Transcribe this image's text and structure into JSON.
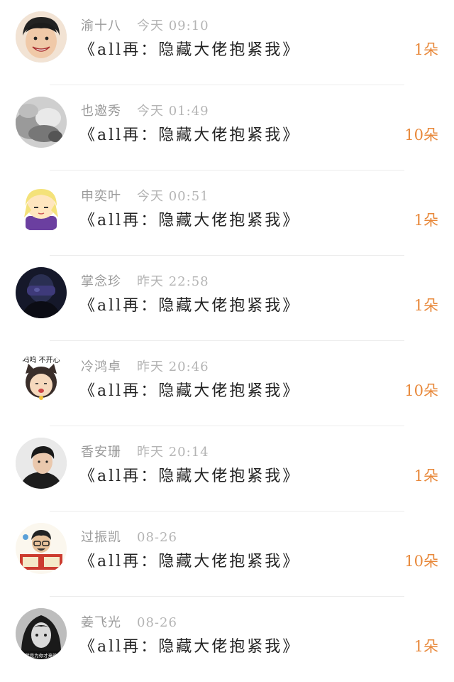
{
  "gifts": [
    {
      "name": "渝十八",
      "time": "今天 09:10",
      "title": "《all再：隐藏大佬抱紧我》",
      "count": "1朵",
      "avatar": "boy-smiling"
    },
    {
      "name": "也邀秀",
      "time": "今天 01:49",
      "title": "《all再：隐藏大佬抱紧我》",
      "count": "10朵",
      "avatar": "smoke"
    },
    {
      "name": "申奕叶",
      "time": "今天 00:51",
      "title": "《all再：隐藏大佬抱紧我》",
      "count": "1朵",
      "avatar": "cartoon-blonde"
    },
    {
      "name": "掌念珍",
      "time": "昨天 22:58",
      "title": "《all再：隐藏大佬抱紧我》",
      "count": "1朵",
      "avatar": "dark-figure"
    },
    {
      "name": "冷鸿卓",
      "time": "昨天 20:46",
      "title": "《all再：隐藏大佬抱紧我》",
      "count": "10朵",
      "avatar": "cat-baby-sticker",
      "avatar_text": "呜呜 不开心"
    },
    {
      "name": "香安珊",
      "time": "昨天 20:14",
      "title": "《all再：隐藏大佬抱紧我》",
      "count": "1朵",
      "avatar": "young-man"
    },
    {
      "name": "过振凯",
      "time": "08-26",
      "title": "《all再：隐藏大佬抱紧我》",
      "count": "10朵",
      "avatar": "cartoon-reading"
    },
    {
      "name": "姜飞光",
      "time": "08-26",
      "title": "《all再：隐藏大佬抱紧我》",
      "count": "1朵",
      "avatar": "bw-girl",
      "avatar_text": "我是为你才来的"
    }
  ],
  "colors": {
    "accent": "#e8883a",
    "meta": "#9a9a9a",
    "title": "#222222",
    "divider": "#ececec"
  }
}
